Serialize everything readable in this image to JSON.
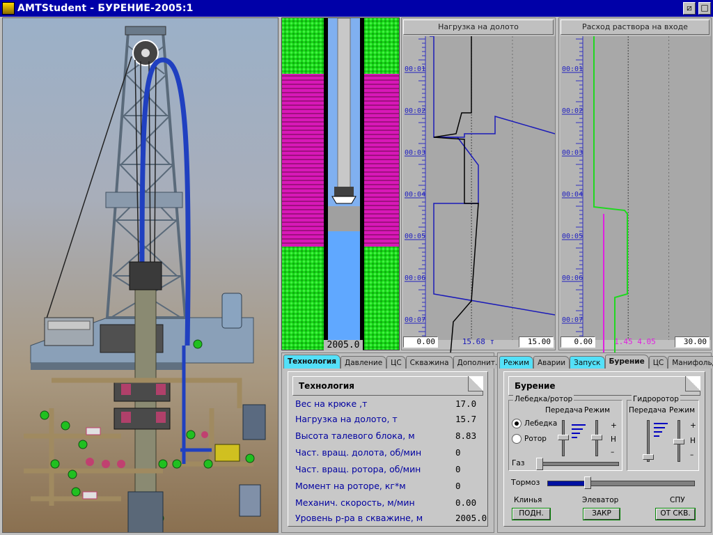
{
  "window": {
    "title": "AMTStudent - БУРЕНИЕ-2005:1"
  },
  "wellbore": {
    "depth_label": "2005.0",
    "fluid_level_pct": 0.58
  },
  "trend_load": {
    "title": "Нагрузка на долото",
    "time_labels": [
      "00:01",
      "00:02",
      "00:03",
      "00:04",
      "00:05",
      "00:06",
      "00:07"
    ],
    "footer_min": "0.00",
    "footer_current": "15.68 т",
    "footer_max": "15.00",
    "colors": {
      "series_blue": "#1a1ab8",
      "series_black": "#000000"
    }
  },
  "trend_flow": {
    "title": "Расход раствора на входе",
    "time_labels": [
      "00:01",
      "00:02",
      "00:03",
      "00:04",
      "00:05",
      "00:06",
      "00:07"
    ],
    "footer_min": "0.00",
    "footer_current": "1.45 4.05",
    "footer_max": "30.00",
    "colors": {
      "series_green": "#20d820",
      "series_magenta": "#e020e0"
    }
  },
  "left_panel": {
    "tabs": [
      "Технология",
      "Давление",
      "ЦС",
      "Скважина",
      "Дополнит."
    ],
    "active_tab": "Технология",
    "header": "Технология",
    "params": [
      {
        "label": "Вес на крюке ,т",
        "value": "17.0"
      },
      {
        "label": "Нагрузка на долото, т",
        "value": "15.7"
      },
      {
        "label": "Высота талевого блока, м",
        "value": "8.83"
      },
      {
        "label": "Част. вращ. долота, об/мин",
        "value": "0"
      },
      {
        "label": "Част. вращ. ротора, об/мин",
        "value": "0"
      },
      {
        "label": "Момент на роторе, кг*м",
        "value": "0"
      },
      {
        "label": "Механич. скорость, м/мин",
        "value": "0.00"
      },
      {
        "label": "Уровень р-ра в скважине, м",
        "value": "2005.0"
      }
    ]
  },
  "right_panel": {
    "tabs": [
      "Режим",
      "Аварии",
      "Запуск",
      "Бурение",
      "ЦС",
      "Манифольд"
    ],
    "tab_arrow": "▶",
    "active_tab": "Бурение",
    "header": "Бурение",
    "winch_group": "Лебедка/ротор",
    "hydro_group": "Гидроротор",
    "gear_label": "Передача",
    "mode_label": "Режим",
    "radio_winch": "Лебедка",
    "radio_rotor": "Ротор",
    "plus": "+",
    "neutral": "Н",
    "minus": "–",
    "gas_label": "Газ",
    "brake_label": "Тормоз",
    "wedges_label": "Клинья",
    "elevator_label": "Элеватор",
    "spu_label": "СПУ",
    "btn_wedges": "ПОДН.",
    "btn_elevator": "ЗАКР",
    "btn_spu": "ОТ СКВ.",
    "brake_level": 0.27
  }
}
